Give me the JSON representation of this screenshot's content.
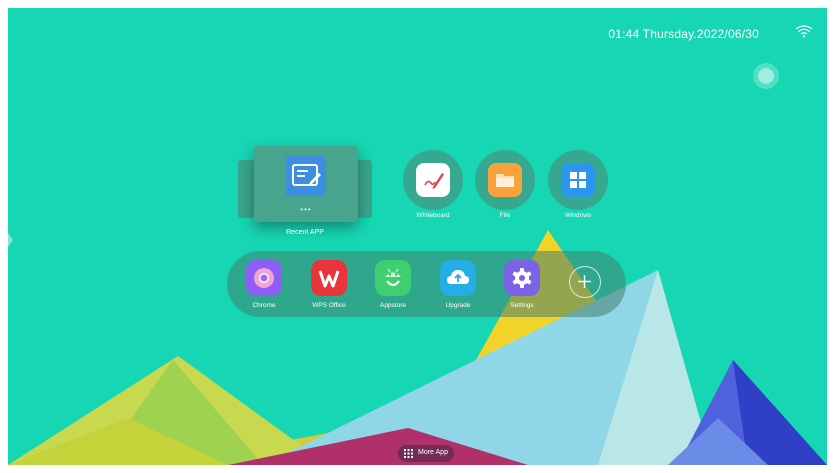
{
  "statusbar": {
    "datetime": "01:44 Thursday.2022/06/30",
    "wifi_icon": "wifi-icon"
  },
  "recent": {
    "label": "Recent APP",
    "dots": "•••",
    "thumbnail_icon": "note-editor-icon"
  },
  "quick_apps": [
    {
      "label": "Whiteboard",
      "icon": "whiteboard-icon",
      "color": "#ffffff"
    },
    {
      "label": "File",
      "icon": "folder-icon",
      "color": "#f7a23b"
    },
    {
      "label": "Windows",
      "icon": "windows-icon",
      "color": "#2b95f0"
    }
  ],
  "dock": {
    "apps": [
      {
        "label": "Chrome",
        "icon": "chrome-icon",
        "color": "#8e5df5"
      },
      {
        "label": "WPS Office",
        "icon": "wps-icon",
        "color": "#e8343b"
      },
      {
        "label": "Appstore",
        "icon": "android-icon",
        "color": "#3fcf6f"
      },
      {
        "label": "Upgrade",
        "icon": "cloud-upload-icon",
        "color": "#23aee5"
      },
      {
        "label": "Settings",
        "icon": "gear-icon",
        "color": "#7c63e6"
      }
    ],
    "add_icon": "plus-icon"
  },
  "more_app": {
    "label": "More App",
    "icon": "grid-icon"
  },
  "colors": {
    "background": "#16d6b3"
  }
}
